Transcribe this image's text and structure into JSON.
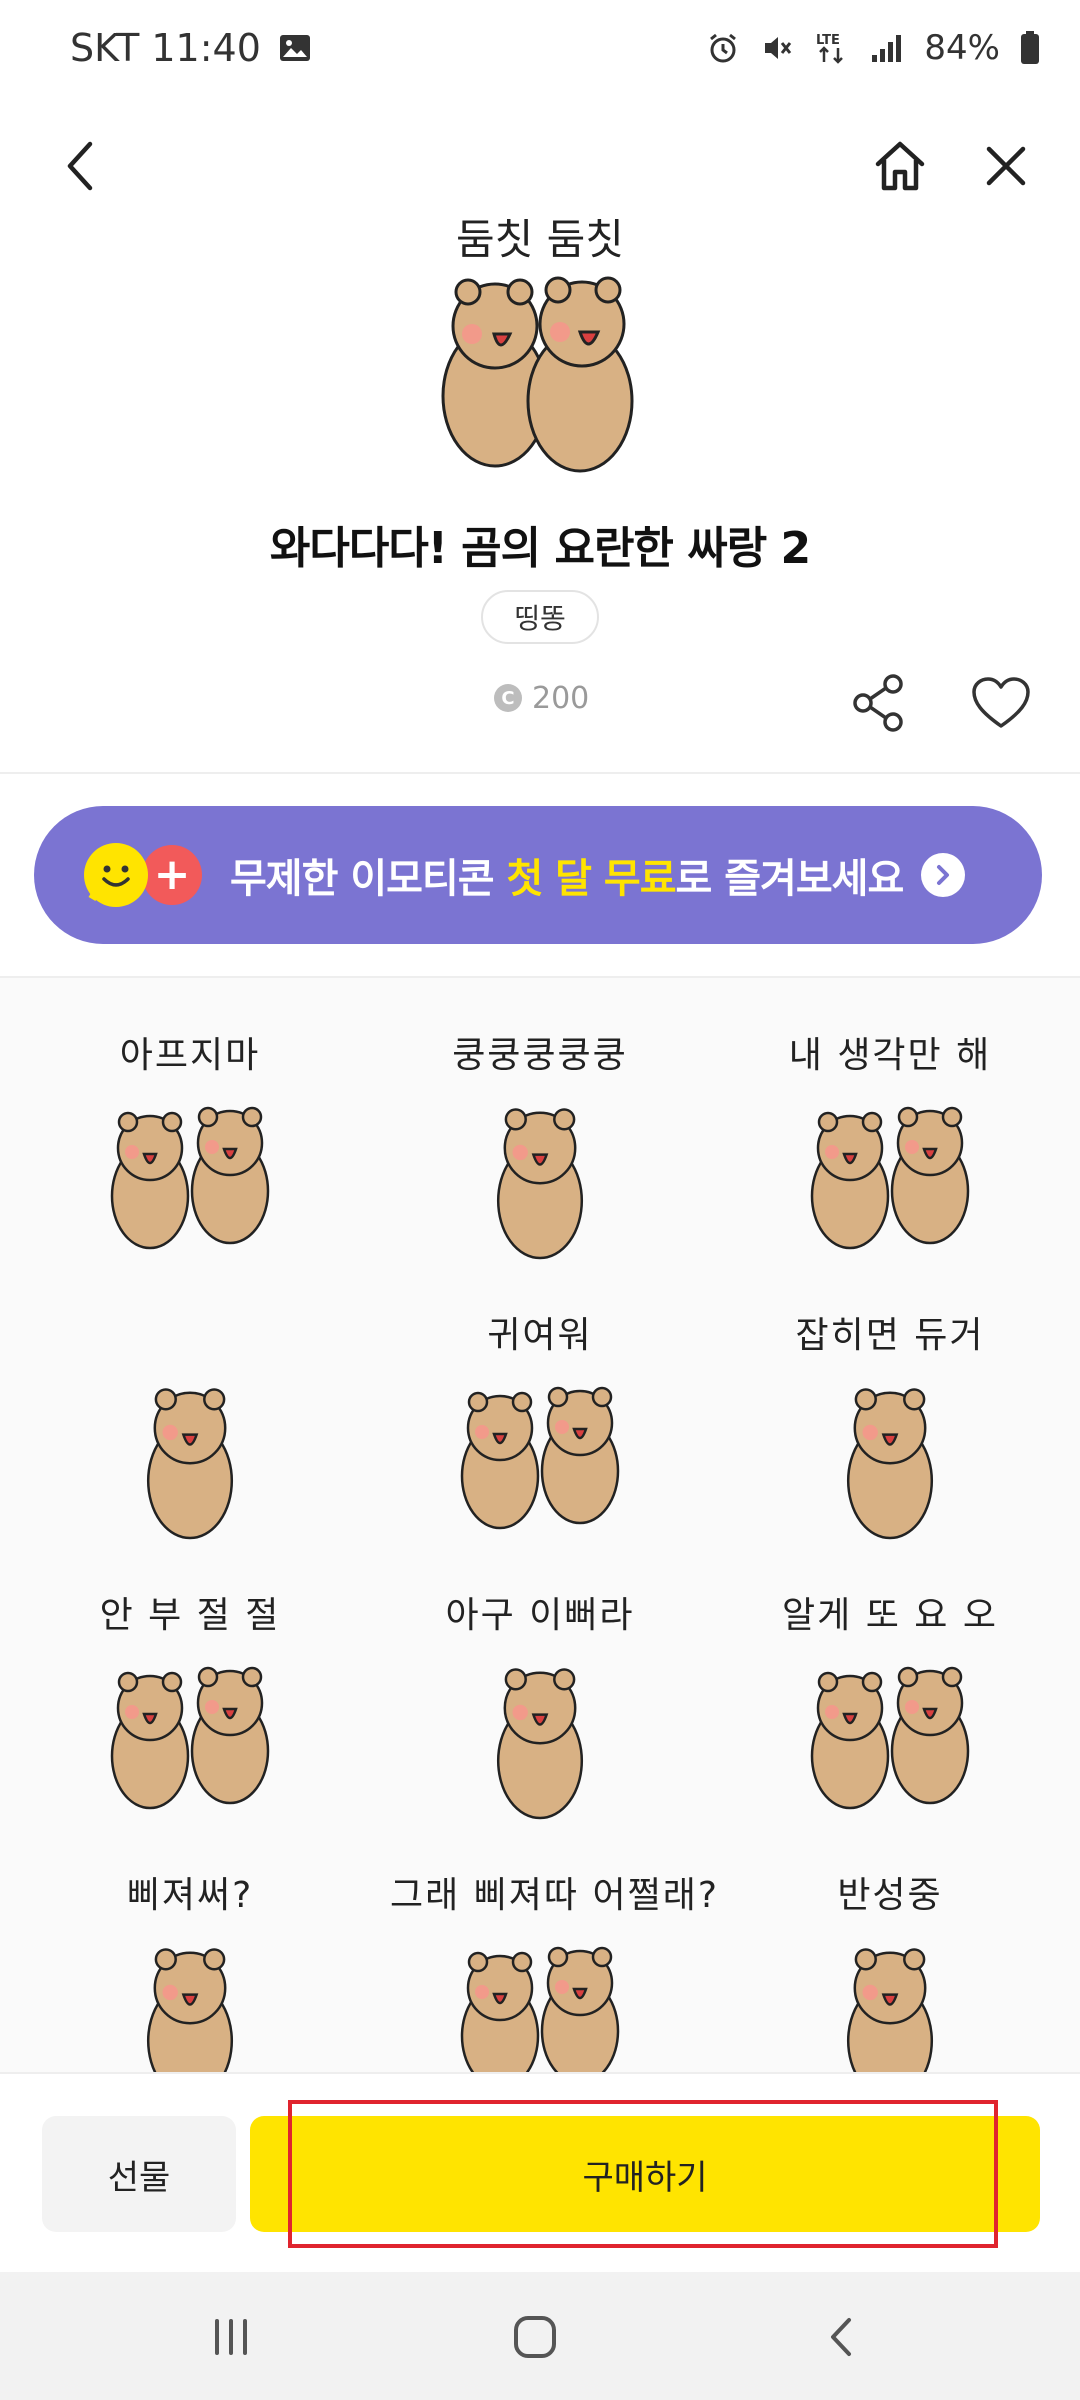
{
  "status_bar": {
    "carrier_time": "SKT 11:40",
    "network": "LTE",
    "battery": "84%",
    "icons": [
      "gallery-icon",
      "alarm-icon",
      "mute-icon",
      "lte-icon",
      "signal-icon",
      "battery-icon"
    ]
  },
  "top_bar": {
    "icons": [
      "back-arrow-icon",
      "home-icon",
      "close-icon"
    ]
  },
  "pack": {
    "hero_caption": "둠칫 둠칫",
    "title": "와다다다! 곰의 요란한 싸랑 2",
    "author": "띵똥",
    "price_icon": "C",
    "price": "200"
  },
  "promo": {
    "text_before": "무제한 이모티콘 ",
    "text_highlight": "첫 달 무료",
    "text_after": "로 즐겨보세요",
    "plus": "+",
    "colors": {
      "background": "#7b74d2",
      "highlight": "#ffe400"
    }
  },
  "emoticons": [
    {
      "caption": "아프지마"
    },
    {
      "caption": "쿵쿵쿵쿵쿵"
    },
    {
      "caption": "내 생각만 해"
    },
    {
      "caption": ""
    },
    {
      "caption": "귀여워"
    },
    {
      "caption": "잡히면 듀거"
    },
    {
      "caption": "안 부 절 절"
    },
    {
      "caption": "아구 이뻐라"
    },
    {
      "caption": "알게 또 요 오"
    },
    {
      "caption": "삐져써?"
    },
    {
      "caption": "그래 삐져따 어쩔래?"
    },
    {
      "caption": "반성중"
    }
  ],
  "actions": {
    "gift_label": "선물",
    "buy_label": "구매하기",
    "colors": {
      "buy": "#ffe400",
      "highlight_box": "#e0242e"
    }
  },
  "nav_bar": {
    "icons": [
      "recent-apps-icon",
      "home-circle-icon",
      "nav-back-icon"
    ]
  }
}
